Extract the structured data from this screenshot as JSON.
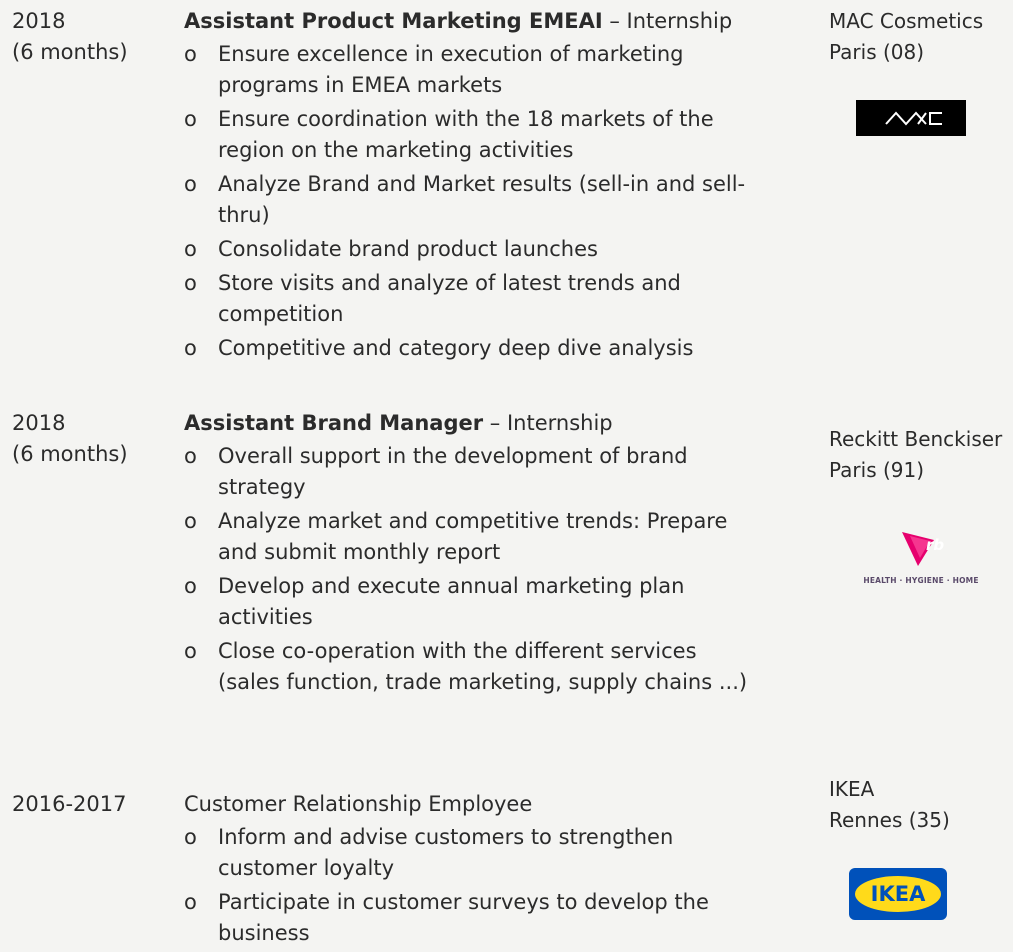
{
  "entries": [
    {
      "date_line1": "2018",
      "date_line2": "(6 months)",
      "title": "Assistant Product Marketing EMEAI",
      "suffix": " – Internship",
      "bullets": [
        "Ensure excellence in execution of marketing programs in EMEA markets",
        "Ensure coordination with the 18 markets of the region on the marketing activities",
        "Analyze Brand and Market results (sell-in and sell-thru)",
        "Consolidate brand product launches",
        "Store visits and analyze of latest trends and competition",
        "Competitive and category deep dive analysis"
      ],
      "company": "MAC Cosmetics",
      "location": "Paris (08)",
      "logo": "mac-logo"
    },
    {
      "date_line1": "2018",
      "date_line2": "(6 months)",
      "title": "Assistant Brand Manager",
      "suffix": " – Internship",
      "bullets": [
        " Overall support in the development of brand strategy",
        "Analyze market and competitive trends: Prepare and submit monthly report",
        "Develop and execute annual marketing plan activities",
        "Close co-operation with the different services (sales function, trade marketing, supply chains ...)"
      ],
      "company": "Reckitt Benckiser",
      "location": "Paris (91)",
      "logo": "rb-logo",
      "logo_text": "HEALTH · HYGIENE · HOME"
    },
    {
      "date_line1": "2016-2017",
      "title": "Customer Relationship Employee",
      "bullets": [
        "Inform and advise customers to strengthen customer loyalty",
        "Participate in customer surveys to develop the business"
      ],
      "company": "IKEA",
      "location": "Rennes (35)",
      "logo": "ikea-logo",
      "logo_text": "IKEA"
    }
  ],
  "bullet_marker": "o",
  "colors": {
    "text": "#2b2b2b",
    "background": "#f4f4f2",
    "ikea_blue": "#0051ba",
    "ikea_yellow": "#ffda1a",
    "rb_pink": "#e6006e"
  }
}
